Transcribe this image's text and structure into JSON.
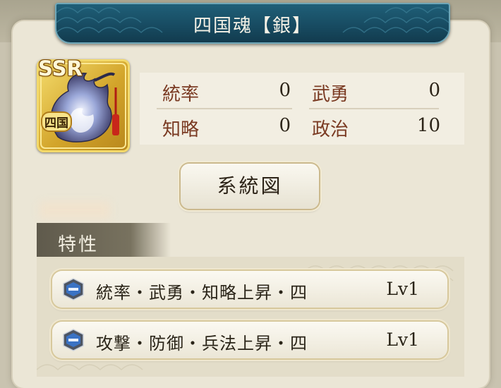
{
  "title": "四国魂【銀】",
  "card": {
    "rarity": "SSR",
    "emblem_text": "四国",
    "icon": "soul-flame-icon"
  },
  "stats": {
    "leadership": {
      "label": "統率",
      "value": "0"
    },
    "valor": {
      "label": "武勇",
      "value": "0"
    },
    "intellect": {
      "label": "知略",
      "value": "0"
    },
    "politics": {
      "label": "政治",
      "value": "10"
    }
  },
  "lineage_button": "系統図",
  "traits_section": {
    "title": "特性",
    "items": [
      {
        "label": "統率・武勇・知略上昇・四",
        "level": "Lv1",
        "icon": "trait-shield-icon"
      },
      {
        "label": "攻撃・防御・兵法上昇・四",
        "level": "Lv1",
        "icon": "trait-shield-icon"
      }
    ]
  },
  "colors": {
    "banner": "#1f5f78",
    "stat_label": "#7a3a22",
    "gold_frame": "#d3a52b",
    "trait_icon_blue": "#3a72c4"
  }
}
